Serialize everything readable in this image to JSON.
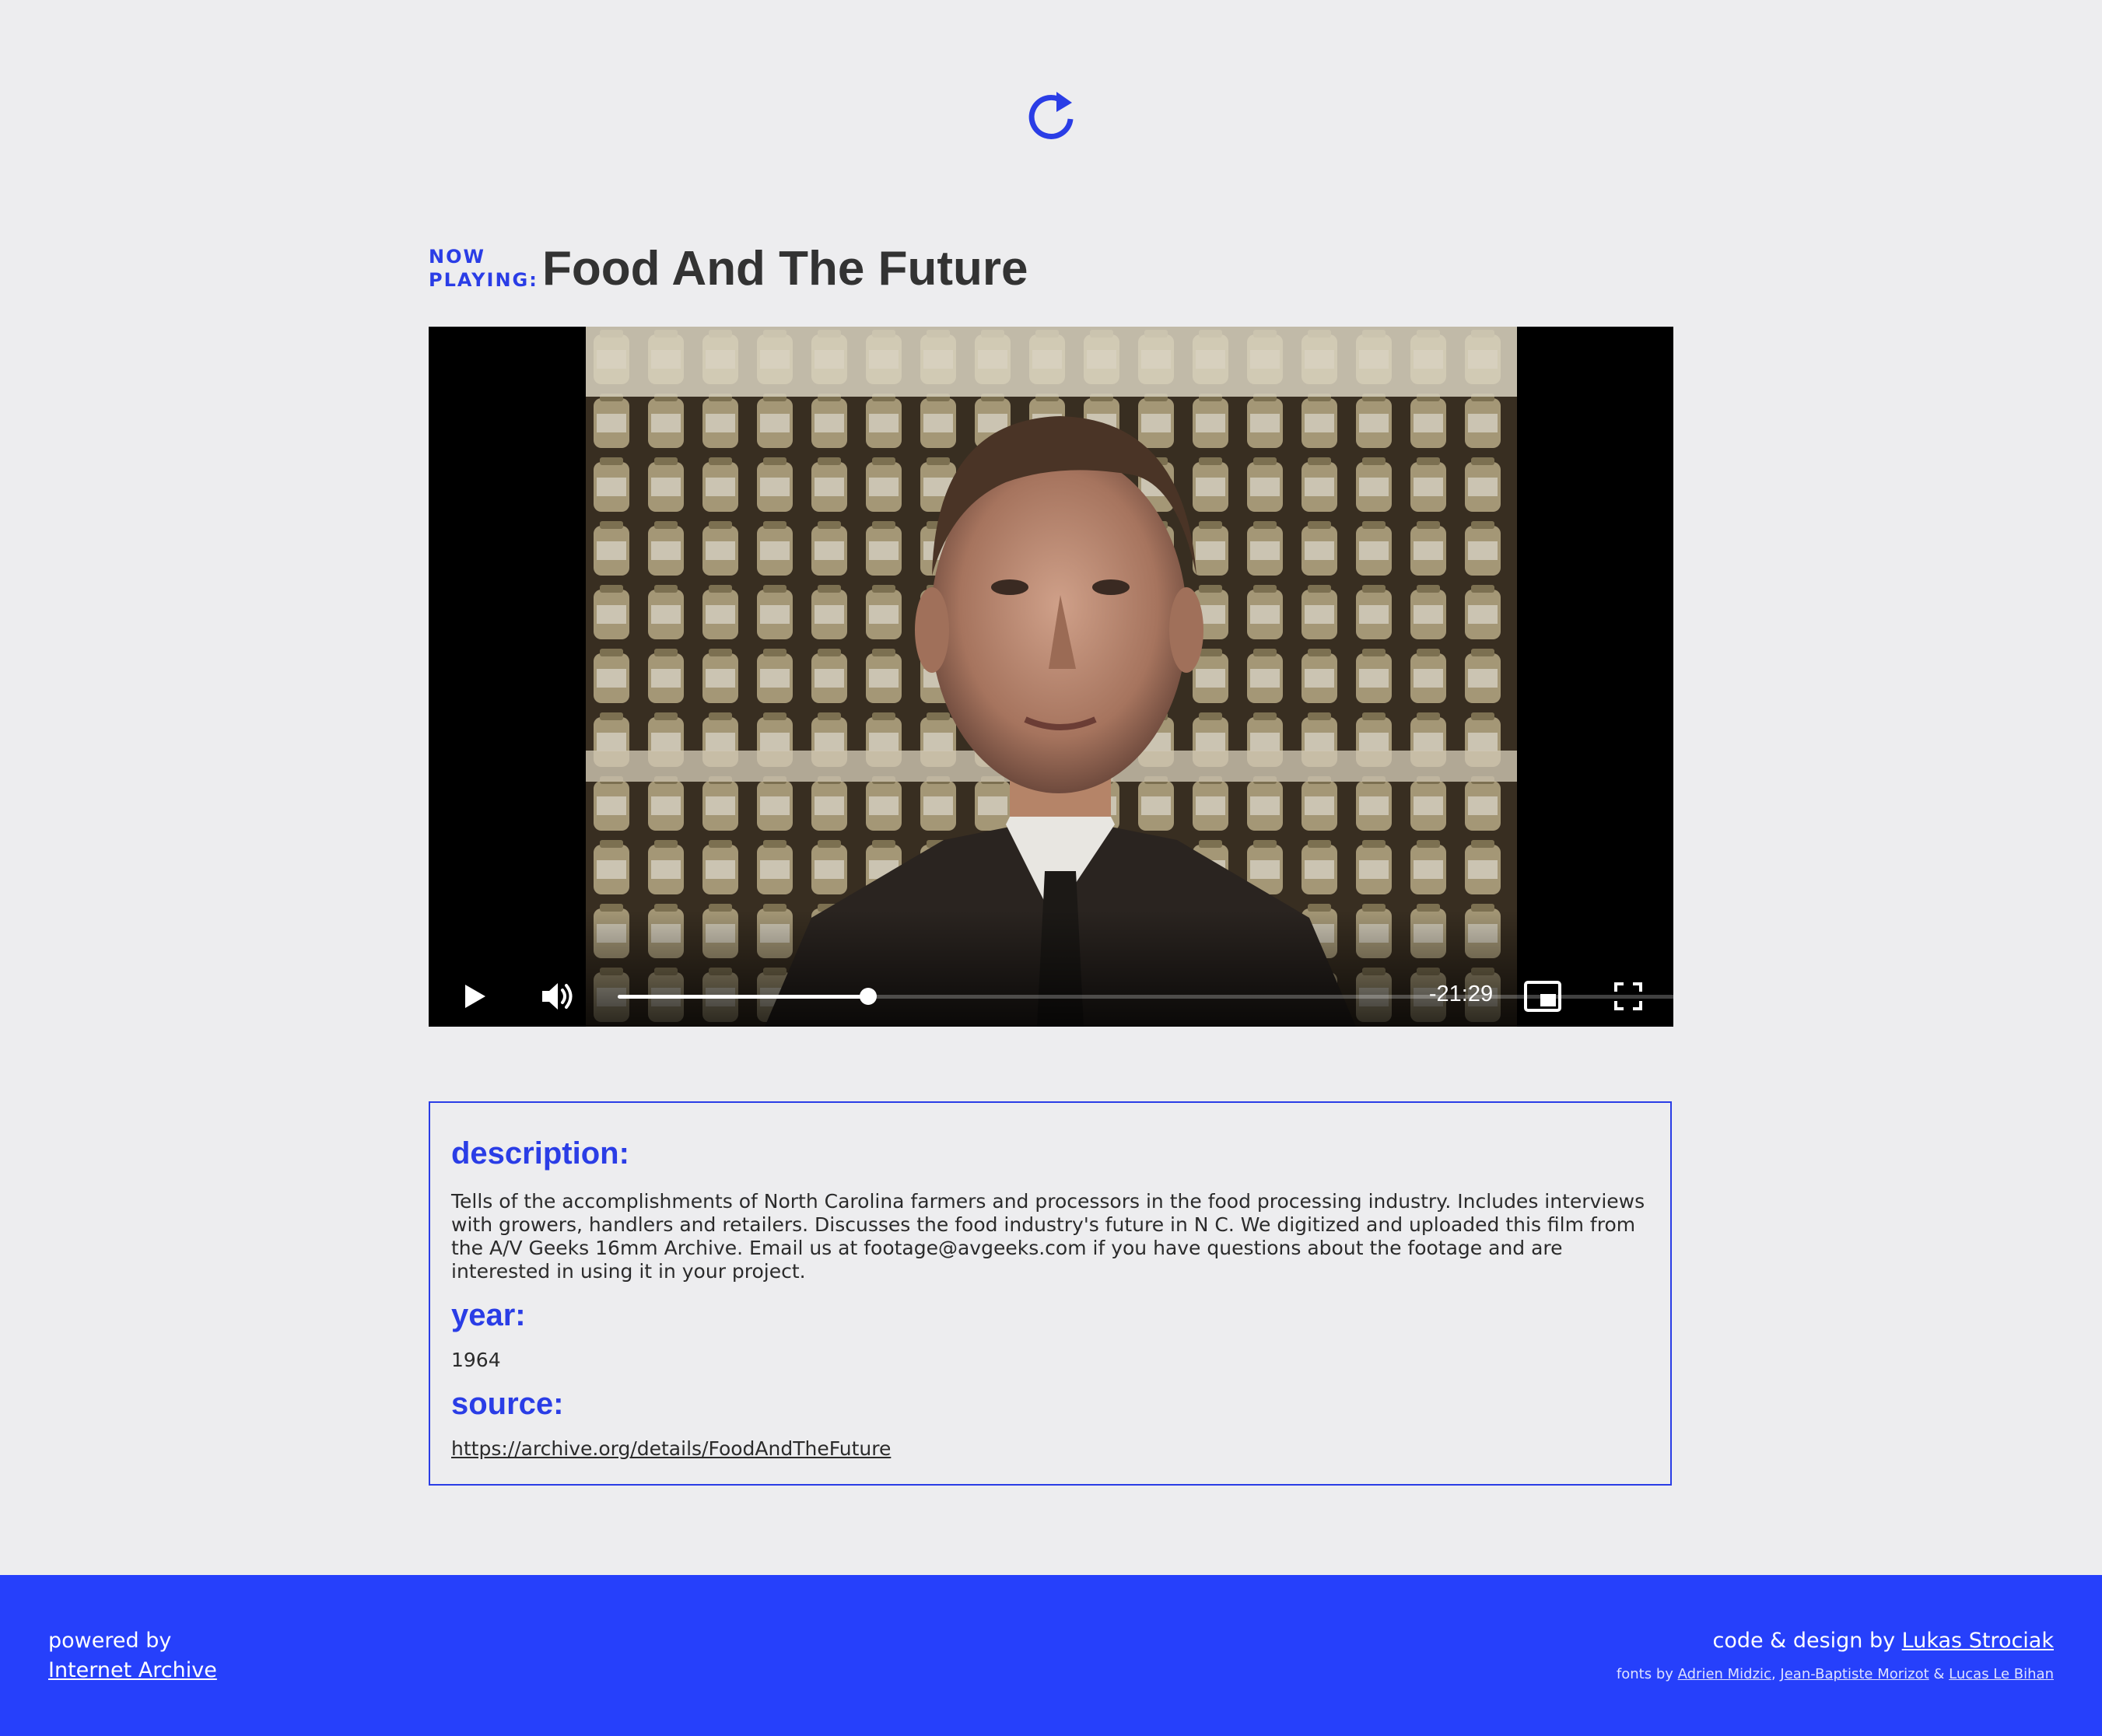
{
  "header": {
    "reload_icon": "reload-icon",
    "now_playing_line1": "NOW",
    "now_playing_line2": "PLAYING:",
    "title": "Food And The Future"
  },
  "player": {
    "play_icon": "play-icon",
    "volume_icon": "volume-icon",
    "progress_fraction": 0.21,
    "time_remaining": "-21:29",
    "pip_icon": "picture-in-picture-icon",
    "fullscreen_icon": "fullscreen-icon"
  },
  "info": {
    "description_heading": "description:",
    "description_text": "Tells of the accomplishments of North Carolina farmers and processors in the food processing industry. Includes interviews with growers, handlers and retailers. Discusses the food industry's future in N C. We digitized and uploaded this film from the A/V Geeks 16mm Archive. Email us at footage@avgeeks.com if you have questions about the footage and are interested in using it in your project.",
    "year_heading": "year:",
    "year_value": "1964",
    "source_heading": "source:",
    "source_url": "https://archive.org/details/FoodAndTheFuture"
  },
  "footer": {
    "powered_by": "powered by",
    "powered_link": "Internet Archive",
    "code_design_prefix": "code & design by ",
    "author_link": "Lukas Strociak",
    "fonts_prefix": "fonts by ",
    "font_author_1": "Adrien Midzic",
    "font_sep_1": ", ",
    "font_author_2": "Jean-Baptiste Morizot",
    "font_sep_2": " & ",
    "font_author_3": "Lucas Le Bihan"
  },
  "colors": {
    "accent": "#2a3de6",
    "footer_bg": "#2640fb",
    "page_bg": "#ededef",
    "title_text": "#333333"
  }
}
